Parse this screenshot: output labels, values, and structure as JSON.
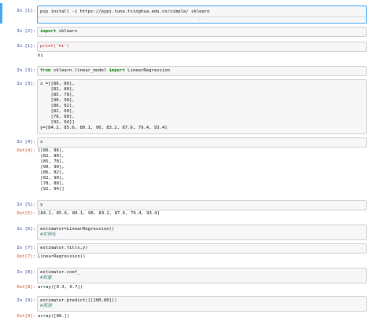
{
  "cells": [
    {
      "in": "In  [1]:",
      "code": "pip install -i https://pypi.tuna.tsinghua.edu.cn/simple/ sklearn",
      "hint": "..."
    },
    {
      "in": "In  [2]:",
      "kw": "import",
      "rest": " sklearn"
    },
    {
      "in": "In  [1]:",
      "code": "print('hi')",
      "out": "hi"
    },
    {
      "in": "In  [3]:",
      "kw1": "from",
      "mid": " sklearn.linear_model ",
      "kw2": "import",
      "rest": " LinearRegression"
    },
    {
      "in": "In  [3]:",
      "lines": [
        "x =[[80, 86],",
        "    [82, 80],",
        "    [85, 78],",
        "    [90, 90],",
        "    [86, 82],",
        "    [82, 90],",
        "    [78, 80],",
        "    [92, 94]]",
        "y=[84.2, 85.6, 80.1, 90, 83.2, 87.6, 79.4, 93.4]"
      ]
    },
    {
      "in": "In  [4]:",
      "code": "x",
      "out_label": "Out[4]:",
      "out_lines": [
        "[[80, 86],",
        " [82, 80],",
        " [85, 78],",
        " [90, 90],",
        " [86, 82],",
        " [82, 90],",
        " [78, 80],",
        " [92, 94]]"
      ]
    },
    {
      "in": "In  [5]:",
      "code": "y",
      "out_label": "Out[5]:",
      "out": "[84.2, 85.6, 80.1, 90, 83.2, 87.6, 79.4, 93.4]"
    },
    {
      "in": "In  [6]:",
      "code": "estimator=LinearRegression()",
      "comment": "#实例化"
    },
    {
      "in": "In  [7]:",
      "code": "estimator.fit(x,y)",
      "out_label": "Out[7]:",
      "out": "LinearRegression()"
    },
    {
      "in": "In  [8]:",
      "code": "estimator.coef_",
      "comment": "#权重",
      "out_label": "Out[8]:",
      "out": "array([0.3, 0.7])"
    },
    {
      "in": "In  [9]:",
      "code": "estimator.predict([[100,80]])",
      "comment": "#预测",
      "out_label": "Out[9]:",
      "out": "array([86.])"
    }
  ]
}
